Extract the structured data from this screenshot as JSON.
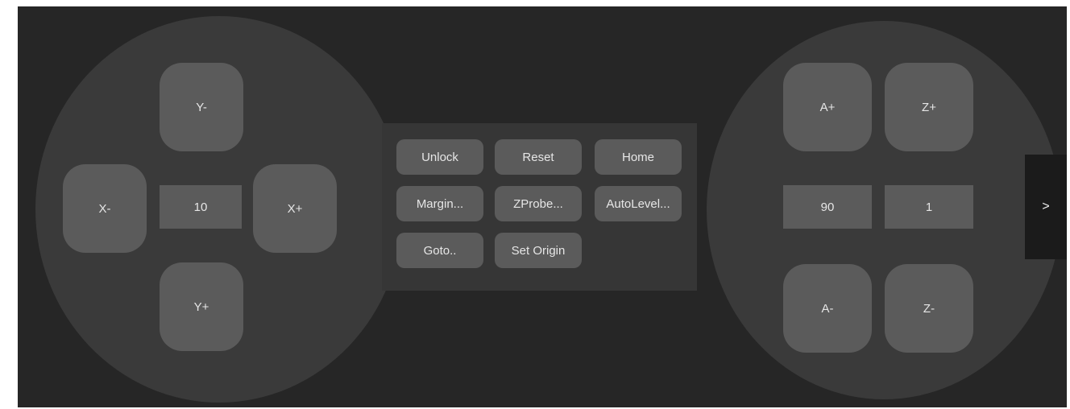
{
  "xy_pad": {
    "y_minus": "Y-",
    "y_plus": "Y+",
    "x_minus": "X-",
    "x_plus": "X+",
    "step_value": "10"
  },
  "commands": {
    "unlock": "Unlock",
    "reset": "Reset",
    "home": "Home",
    "margin": "Margin...",
    "zprobe": "ZProbe...",
    "autolevel": "AutoLevel...",
    "goto": "Goto..",
    "set_origin": "Set Origin"
  },
  "az_pad": {
    "a_plus": "A+",
    "z_plus": "Z+",
    "a_minus": "A-",
    "z_minus": "Z-",
    "a_step_value": "90",
    "z_step_value": "1"
  },
  "expand_button": ">"
}
